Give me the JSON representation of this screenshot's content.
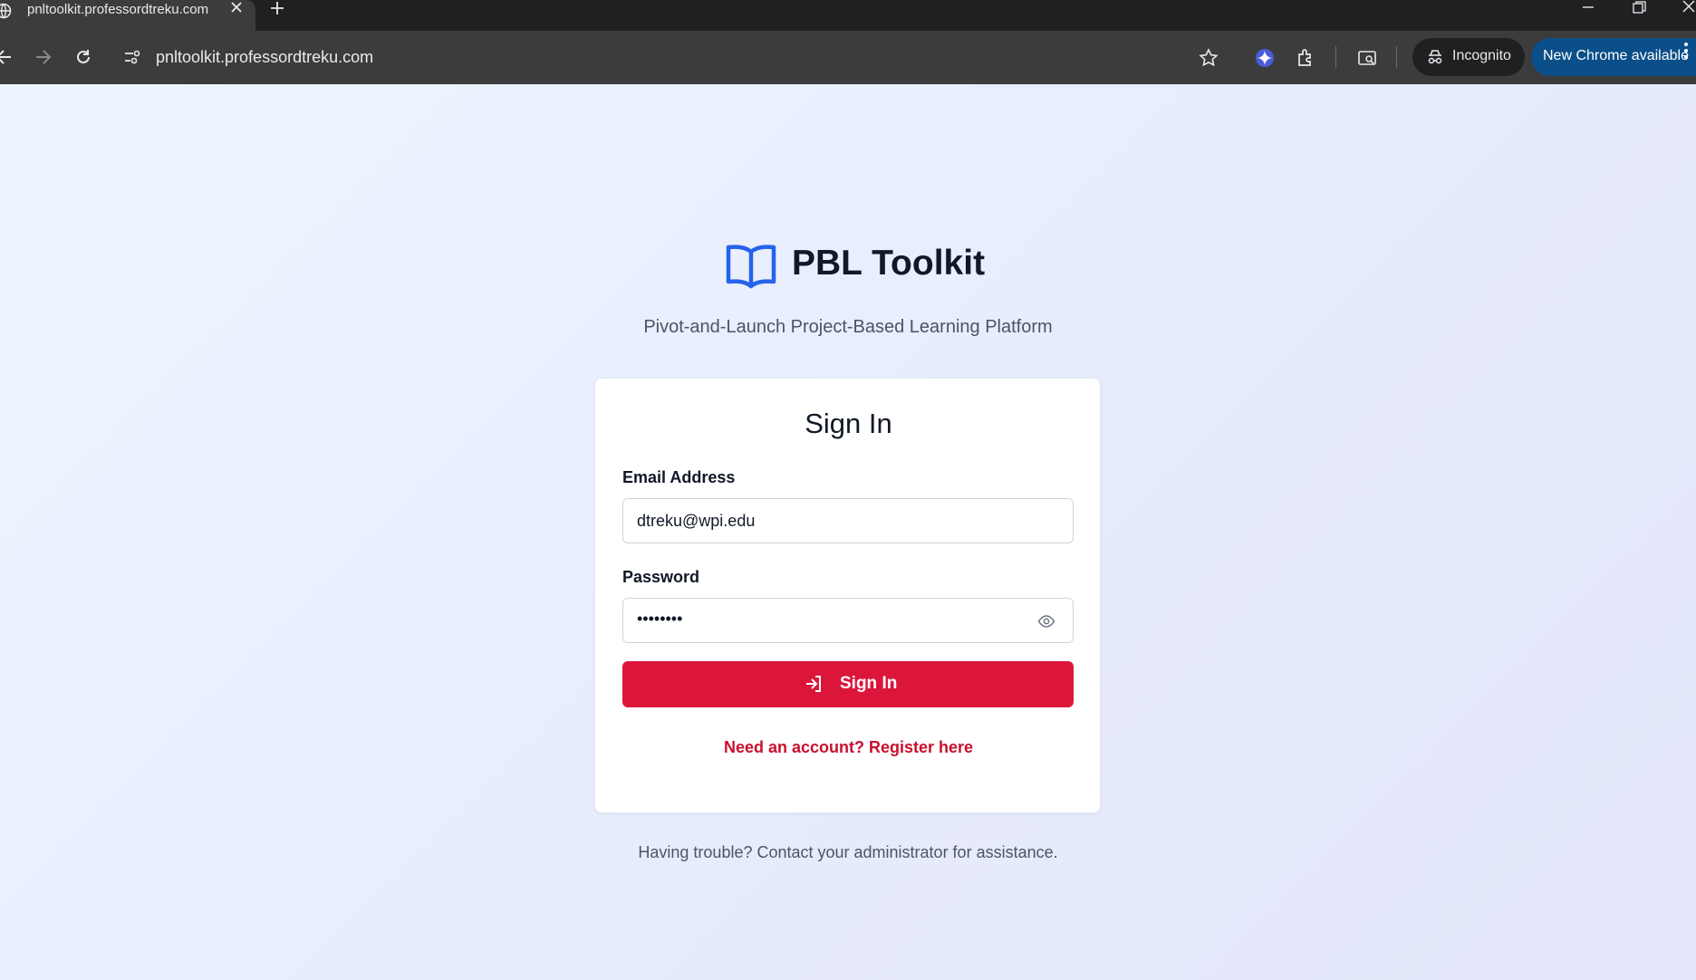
{
  "browser": {
    "tab_title": "pnltoolkit.professordtreku.com",
    "url": "pnltoolkit.professordtreku.com",
    "incognito_label": "Incognito",
    "update_label": "New Chrome available"
  },
  "page": {
    "app_title": "PBL Toolkit",
    "subtitle": "Pivot-and-Launch Project-Based Learning Platform",
    "footer_help": "Having trouble? Contact your administrator for assistance."
  },
  "signin_form": {
    "title": "Sign In",
    "email_label": "Email Address",
    "email_value": "dtreku@wpi.edu",
    "password_label": "Password",
    "password_masked": "••••••••",
    "submit_label": "Sign In",
    "register_link": "Need an account? Register here"
  },
  "colors": {
    "accent": "#dc163b",
    "link": "#c8102e",
    "logo": "#2563eb",
    "chrome_update": "#0b4f8a"
  }
}
